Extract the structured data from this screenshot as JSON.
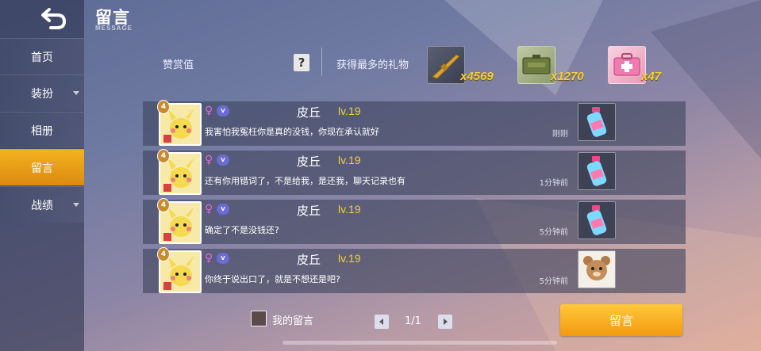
{
  "header": {
    "title": "留言",
    "subtitle": "MESSAGE"
  },
  "sidebar": {
    "back_icon": "back-arrow-icon",
    "items": [
      {
        "label": "首页",
        "has_dropdown": false,
        "active": false
      },
      {
        "label": "装扮",
        "has_dropdown": true,
        "active": false
      },
      {
        "label": "相册",
        "has_dropdown": false,
        "active": false
      },
      {
        "label": "留言",
        "has_dropdown": false,
        "active": true
      },
      {
        "label": "战绩",
        "has_dropdown": true,
        "active": false
      }
    ]
  },
  "stats": {
    "reward_label": "赞赏值",
    "help_label": "?",
    "top_gifts_label": "获得最多的礼物",
    "gifts": [
      {
        "icon": "rifle-gift-icon",
        "count": "x4569"
      },
      {
        "icon": "ammo-box-gift-icon",
        "count": "x1270"
      },
      {
        "icon": "medkit-gift-icon",
        "count": "x47"
      }
    ]
  },
  "messages": [
    {
      "level_badge": "4",
      "name": "皮丘",
      "level": "lv.19",
      "text": "我害怕我冤枉你是真的没钱，你现在承认就好",
      "time": "刚刚",
      "gift_icon": "drink-bottle-gift-icon"
    },
    {
      "level_badge": "4",
      "name": "皮丘",
      "level": "lv.19",
      "text": "还有你用错词了，不是给我，是还我，聊天记录也有",
      "time": "1分钟前",
      "gift_icon": "drink-bottle-gift-icon"
    },
    {
      "level_badge": "4",
      "name": "皮丘",
      "level": "lv.19",
      "text": "确定了不是没钱还?",
      "time": "5分钟前",
      "gift_icon": "drink-bottle-gift-icon"
    },
    {
      "level_badge": "4",
      "name": "皮丘",
      "level": "lv.19",
      "text": "你终于说出口了，就是不想还是吧?",
      "time": "5分钟前",
      "gift_icon": "teddy-bear-gift-icon"
    }
  ],
  "footer": {
    "my_messages_label": "我的留言",
    "page_text": "1/1",
    "post_button_label": "留言"
  },
  "colors": {
    "accent": "#f3a81a",
    "level_text": "#f4cf3a",
    "gift_count": "#f4cf3a"
  }
}
